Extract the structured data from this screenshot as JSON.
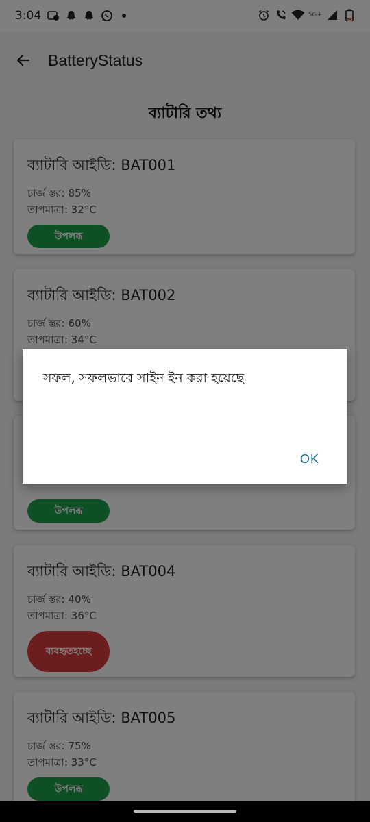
{
  "status_bar": {
    "time": "3:04",
    "network_label": "5G+",
    "icons_left": [
      "photos-icon",
      "snapchat-icon",
      "snapchat-icon",
      "whatsapp-icon"
    ],
    "icons_right": [
      "alarm-icon",
      "wifi-calling-icon",
      "wifi-icon",
      "signal-icon",
      "battery-icon"
    ]
  },
  "app_bar": {
    "title": "BatteryStatus"
  },
  "page": {
    "section_title": "ব্যাটারি তথ্য"
  },
  "cards": [
    {
      "id": "ব্যাটারি আইডি: BAT001",
      "charge": "চার্জ স্তর: 85%",
      "temp": "তাপমাত্রা: 32°C",
      "status": "উপলব্ধ",
      "status_type": "available"
    },
    {
      "id": "ব্যাটারি আইডি: BAT002",
      "charge": "চার্জ স্তর: 60%",
      "temp": "তাপমাত্রা: 34°C",
      "status": "",
      "status_type": "in-use"
    },
    {
      "id": "",
      "charge": "",
      "temp": "",
      "status": "উপলব্ধ",
      "status_type": "available"
    },
    {
      "id": "ব্যাটারি আইডি: BAT004",
      "charge": "চার্জ স্তর: 40%",
      "temp": "তাপমাত্রা: 36°C",
      "status_line1": "ব্যবহৃত",
      "status_line2": "হচ্ছে",
      "status_type": "in-use"
    },
    {
      "id": "ব্যাটারি আইডি: BAT005",
      "charge": "চার্জ স্তর: 75%",
      "temp": "তাপমাত্রা: 33°C",
      "status": "উপলব্ধ",
      "status_type": "available"
    }
  ],
  "dialog": {
    "message": "সফল, সফলভাবে সাইন ইন করা হয়েছে",
    "ok_label": "OK"
  },
  "colors": {
    "available": "#1e9e4a",
    "in_use": "#d83a3a",
    "dialog_button": "#1a6e90"
  }
}
